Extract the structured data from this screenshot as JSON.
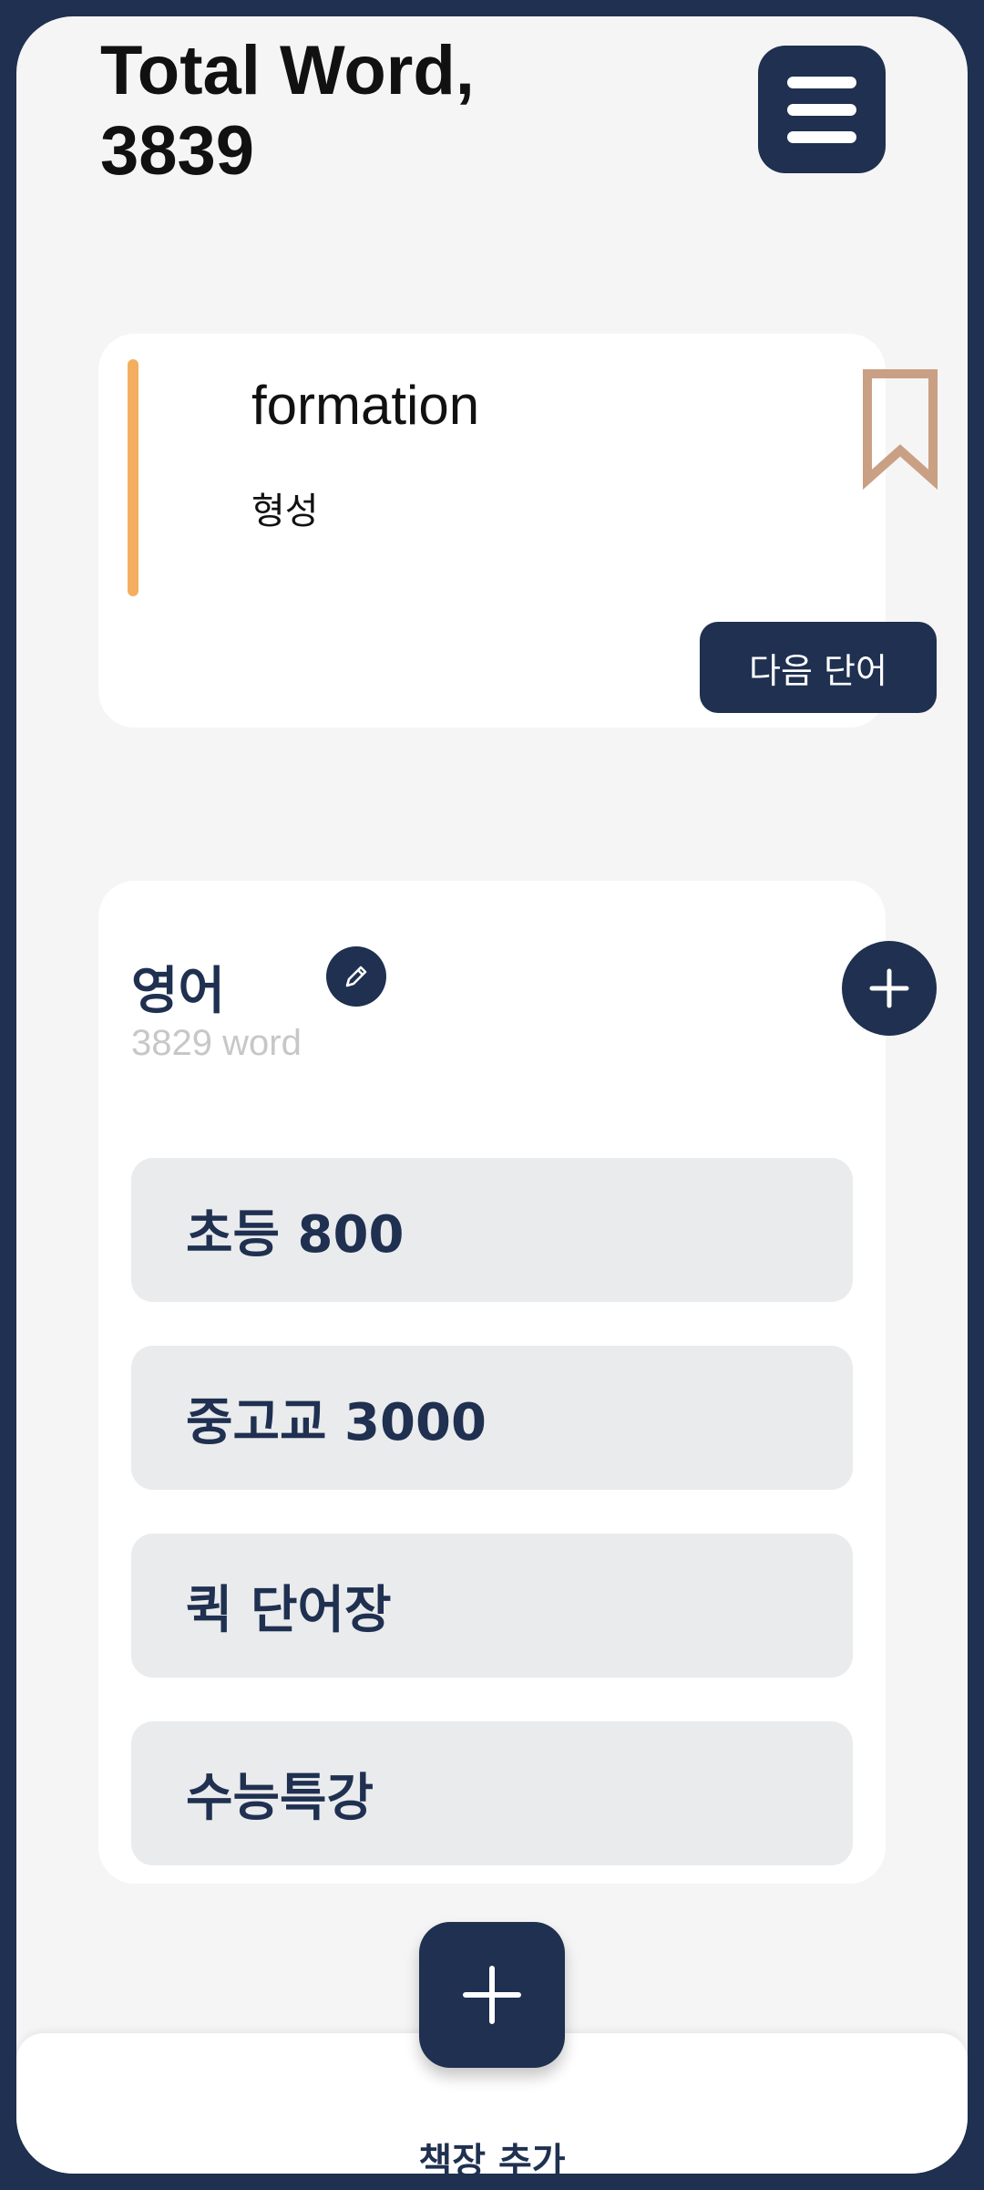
{
  "header": {
    "title_line1": "Total Word,",
    "title_line2": "3839",
    "menu_icon": "hamburger-menu-icon"
  },
  "word_card": {
    "word": "formation",
    "meaning": "형성",
    "next_label": "다음 단어",
    "bookmark_icon": "bookmark-icon",
    "accent_color": "#f4ae5f",
    "bookmark_color": "#c9a083"
  },
  "book": {
    "title": "영어",
    "count": "3829",
    "count_unit": "word",
    "edit_icon": "pencil-icon",
    "add_icon": "plus-icon",
    "chapters": [
      {
        "label": "초등 800"
      },
      {
        "label": "중고교 3000"
      },
      {
        "label": "퀵 단어장"
      },
      {
        "label": "수능특강"
      }
    ]
  },
  "bottom": {
    "fab_icon": "plus-icon",
    "label": "책장 추가"
  },
  "colors": {
    "primary": "#1f3050",
    "background": "#f5f5f5",
    "chapter_bg": "#eaebed",
    "muted_text": "#c7c7c7"
  }
}
